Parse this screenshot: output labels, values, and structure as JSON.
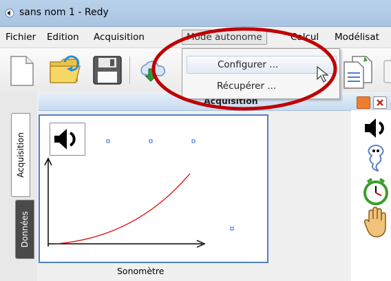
{
  "window": {
    "title": "sans nom 1 - Redy"
  },
  "menubar": {
    "items": [
      "Fichier",
      "Edition",
      "Acquisition",
      "Mode autonome",
      "Calcul",
      "Modélisat"
    ]
  },
  "dropdown": {
    "items": [
      "Configurer ...",
      "Récupérer ..."
    ]
  },
  "panel": {
    "title": "Acquisition"
  },
  "side_tabs": {
    "acquisition": "Acquisition",
    "donnees": "Données"
  },
  "plot": {
    "caption": "Sonomètre"
  },
  "icons": {
    "toolbar": [
      "new-document-icon",
      "open-folder-icon",
      "save-floppy-icon",
      "cloud-download-icon",
      "copy-document-icon"
    ],
    "right": [
      "speaker-icon",
      "ghost-icon",
      "alarm-clock-icon",
      "hand-icon"
    ]
  },
  "colors": {
    "accent": "#4f7fc4",
    "highlight": "#c00000",
    "curve": "#e00000"
  }
}
